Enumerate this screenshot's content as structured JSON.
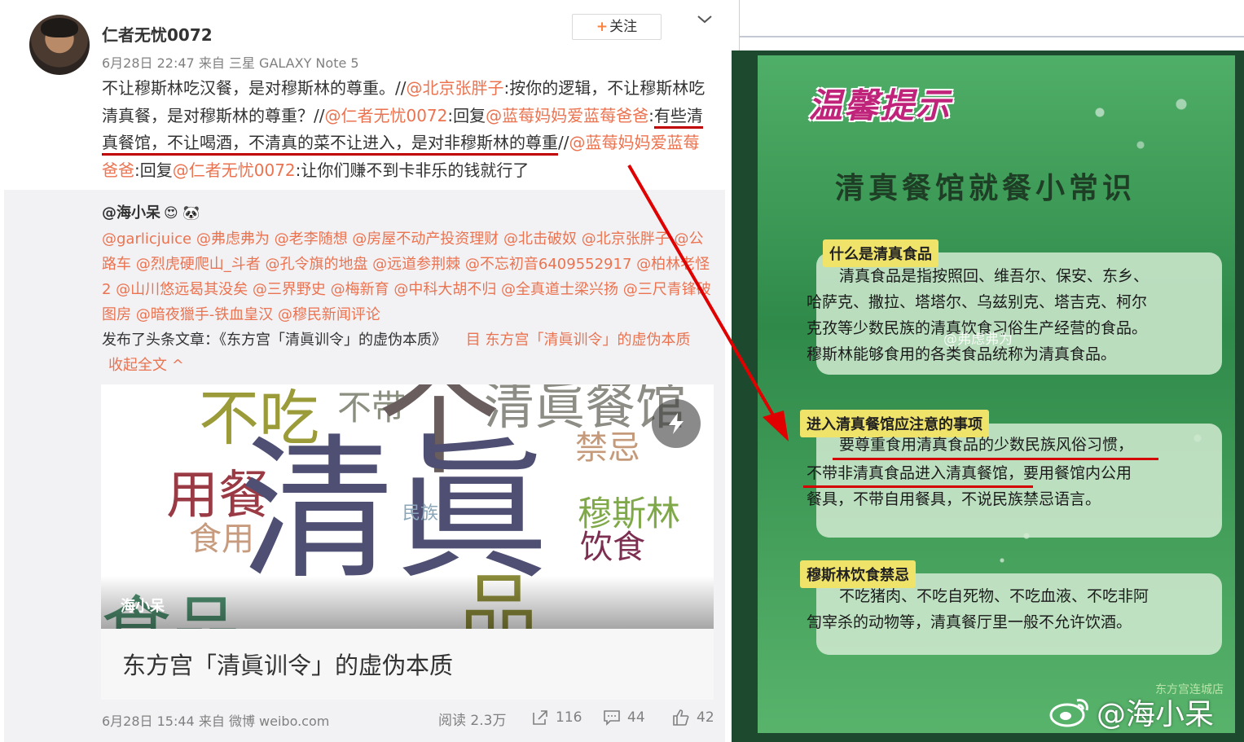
{
  "post": {
    "author": "仁者无忧0072",
    "time": "6月28日 22:47",
    "via_label": "来自",
    "device": "三星 GALAXY Note 5",
    "follow_label": "关注",
    "text": {
      "p1": "不让穆斯林吃汉餐，是对穆斯林的尊重。//",
      "m1": "@北京张胖子",
      "p2": ":按你的逻辑，不让穆斯林吃清真餐，是对穆斯林的尊重？//",
      "m2": "@仁者无忧0072",
      "p3": ":回复",
      "m3": "@蓝莓妈妈爱蓝莓爸爸",
      "p4": ":",
      "p5": "有些清真餐馆，不让喝酒，不清真的菜不让进入，是对非穆斯林的尊重",
      "p6": "//",
      "m4": "@蓝莓妈妈爱蓝莓爸爸",
      "p7": ":回复",
      "m5": "@仁者无忧0072",
      "p8": ":让你们赚不到卡非乐的钱就行了"
    }
  },
  "repost": {
    "author": "@海小呆",
    "emojis": "😍 🐼",
    "mentions": "@garlicjuice @弗虑弗为 @老李随想 @房屋不动产投资理财 @北击破奴 @北京张胖子 @公路车 @烈虎硬爬山_斗者 @孔令旗的地盘 @远道参荆棘 @不忘初音6409552917 @柏林老怪2 @山川悠远曷其没矣 @三界野史 @梅新育 @中科大胡不归 @全真道士梁兴扬 @三尺青锋破图房 @暗夜獵手-铁血皇汉 @穆民新闻评论",
    "published_text": "发布了头条文章：《东方宫「清眞训令」的虚伪本质》",
    "article_link": "目 东方宫「清眞训令」的虚伪本质",
    "collapse_label": "收起全文 ^",
    "card": {
      "words": {
        "w1": "不吃",
        "w2": "不带",
        "w3": "个",
        "w4": "清眞餐馆",
        "w5": "禁忌",
        "w6": "用餐",
        "w7": "清眞",
        "w8": "民族",
        "w9": "穆斯林",
        "w10": "食用",
        "w11": "饮食",
        "w12": "食品",
        "w13": "品"
      },
      "overlay_author": "海小呆",
      "title": "东方宫「清眞训令」的虚伪本质"
    },
    "footer": {
      "time": "6月28日 15:44",
      "via_label": "来自",
      "source": "微博 weibo.com",
      "reads": "阅读 2.3万",
      "shares": "116",
      "comments": "44",
      "likes": "42"
    }
  },
  "poster": {
    "headline": "温馨提示",
    "title": "清真餐馆就餐小常识",
    "section1": {
      "label": "什么是清真食品",
      "line1": "清真食品是指按照回、维吾尔、保安、东乡、",
      "line2": "哈萨克、撒拉、塔塔尔、乌兹别克、塔吉克、柯尔",
      "line3": "克孜等少数民族的清真饮食习俗生产经营的食品。",
      "line4": "穆斯林能够食用的各类食品统称为清真食品。"
    },
    "section2": {
      "label": "进入清真餐馆应注意的事项",
      "line1": "要尊重食用清真食品的少数民族风俗习惯，",
      "line2": "不带非清真食品进入清真餐馆，要用餐馆内公用",
      "line3": "餐具，不带自用餐具，不说民族禁忌语言。"
    },
    "section3": {
      "label": "穆斯林饮食禁忌",
      "line1": "不吃猪肉、不吃自死物、不吃血液、不吃非阿",
      "line2": "訇宰杀的动物等，清真餐厅里一般不允许饮酒。"
    },
    "small_watermark": "@弗虑弗为",
    "store": "东方宫连城店",
    "weibo_watermark": "@海小呆"
  },
  "colors": {
    "mention": "#eb7350",
    "underline": "#c00000",
    "arrow": "#e00000",
    "poster_green": "#3f9a58",
    "headline_pink": "#c0247a"
  }
}
